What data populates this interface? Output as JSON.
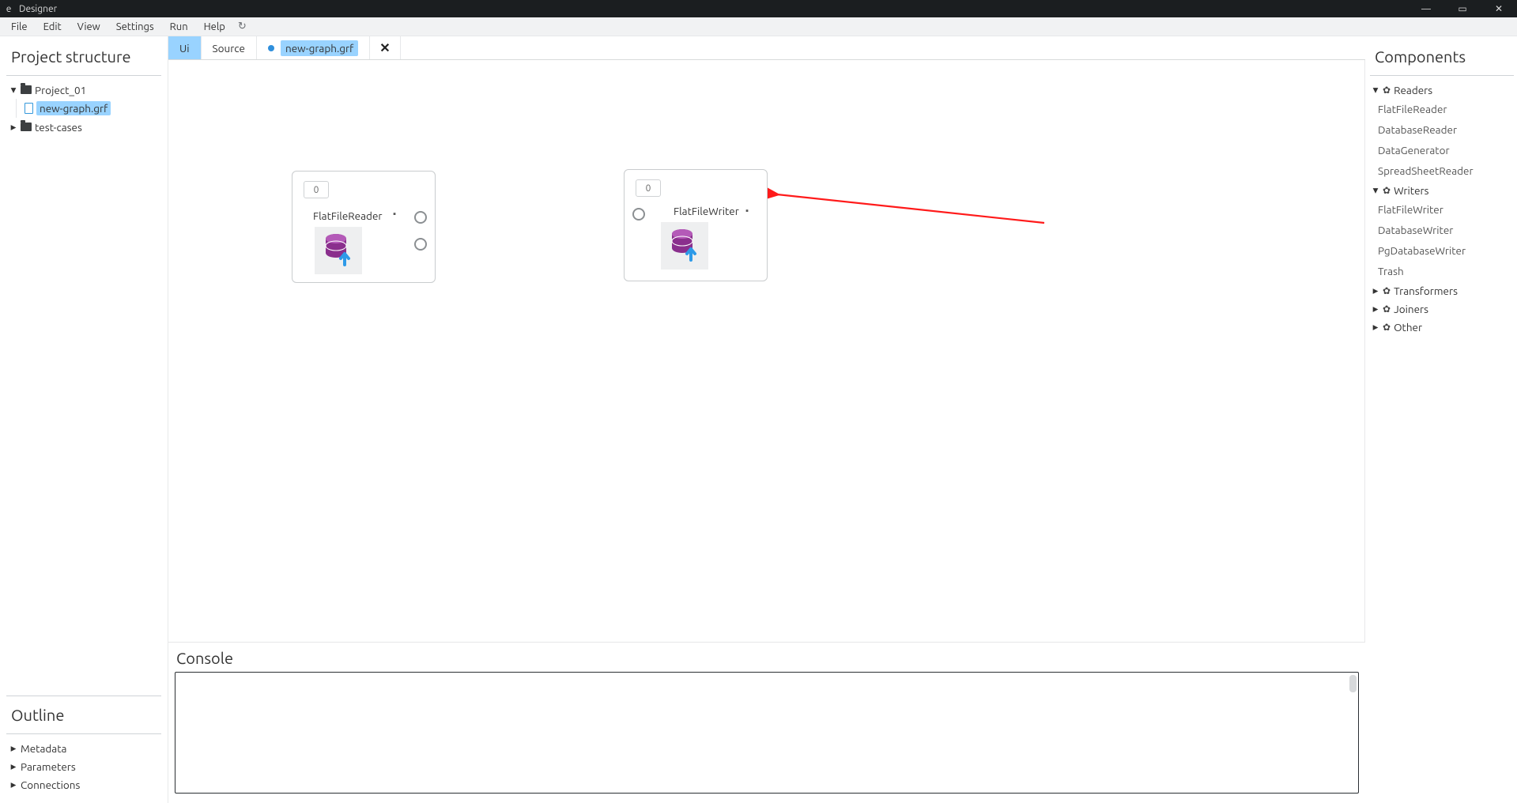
{
  "window": {
    "app_glyph": "e",
    "title": "Designer"
  },
  "menu": {
    "items": [
      "File",
      "Edit",
      "View",
      "Settings",
      "Run",
      "Help"
    ]
  },
  "left": {
    "panel_title": "Project structure",
    "project_name": "Project_01",
    "file_name": "new-graph.grf",
    "folder2": "test-cases",
    "outline_title": "Outline",
    "outline_items": [
      "Metadata",
      "Parameters",
      "Connections"
    ]
  },
  "tabs": {
    "ui": "Ui",
    "source": "Source",
    "file": "new-graph.grf"
  },
  "canvas": {
    "reader": {
      "badge": "0",
      "title": "FlatFileReader"
    },
    "writer": {
      "badge": "0",
      "title": "FlatFileWriter"
    }
  },
  "console": {
    "title": "Console"
  },
  "right": {
    "panel_title": "Components",
    "groups": {
      "readers": {
        "label": "Readers",
        "items": [
          "FlatFileReader",
          "DatabaseReader",
          "DataGenerator",
          "SpreadSheetReader"
        ]
      },
      "writers": {
        "label": "Writers",
        "items": [
          "FlatFileWriter",
          "DatabaseWriter",
          "PgDatabaseWriter",
          "Trash"
        ]
      },
      "transformers": {
        "label": "Transformers"
      },
      "joiners": {
        "label": "Joiners"
      },
      "other": {
        "label": "Other"
      }
    }
  }
}
